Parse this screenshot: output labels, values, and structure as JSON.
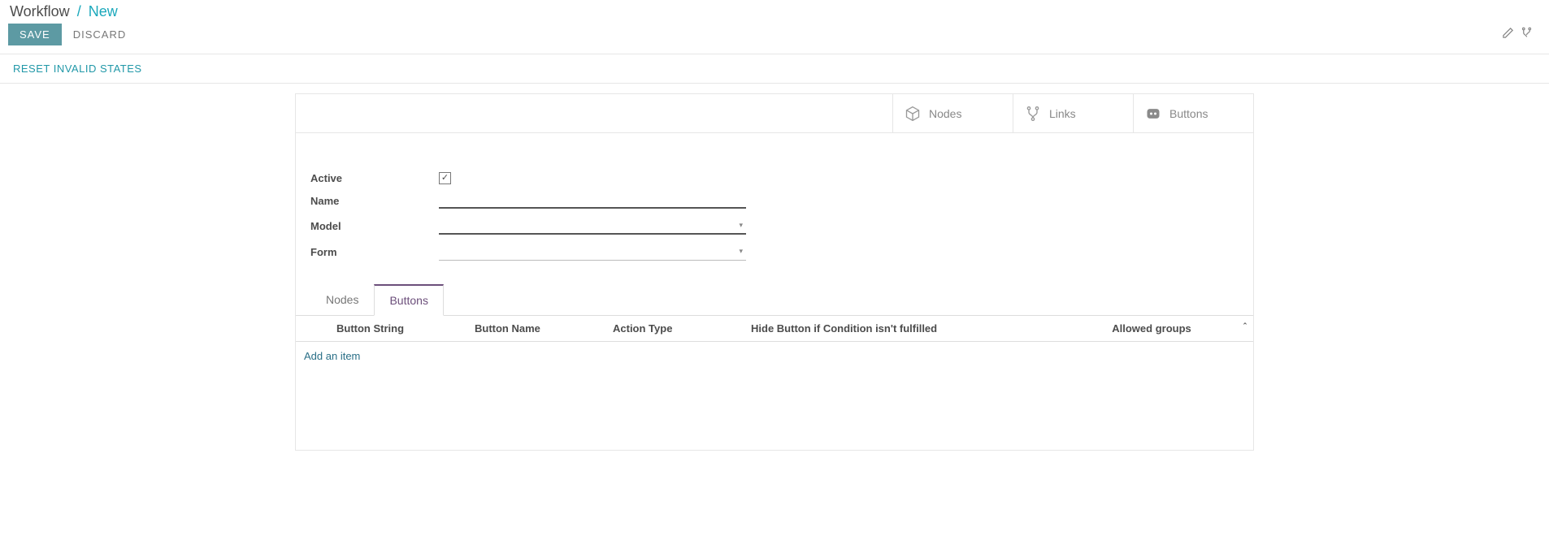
{
  "breadcrumb": {
    "root": "Workflow",
    "sep": "/",
    "current": "New"
  },
  "toolbar": {
    "save": "SAVE",
    "discard": "DISCARD"
  },
  "actions": {
    "reset": "RESET INVALID STATES"
  },
  "stat_buttons": {
    "nodes": "Nodes",
    "links": "Links",
    "buttons": "Buttons"
  },
  "fields": {
    "active_label": "Active",
    "active_value": true,
    "name_label": "Name",
    "name_value": "",
    "model_label": "Model",
    "model_value": "",
    "form_label": "Form",
    "form_value": ""
  },
  "tabs": {
    "nodes": "Nodes",
    "buttons": "Buttons",
    "active": "buttons"
  },
  "grid": {
    "columns": {
      "button_string": "Button String",
      "button_name": "Button Name",
      "action_type": "Action Type",
      "hide_condition": "Hide Button if Condition isn't fulfilled",
      "allowed_groups": "Allowed groups"
    },
    "add_item": "Add an item"
  },
  "caret_glyph": "▾",
  "chevron_glyph": "ˆ"
}
